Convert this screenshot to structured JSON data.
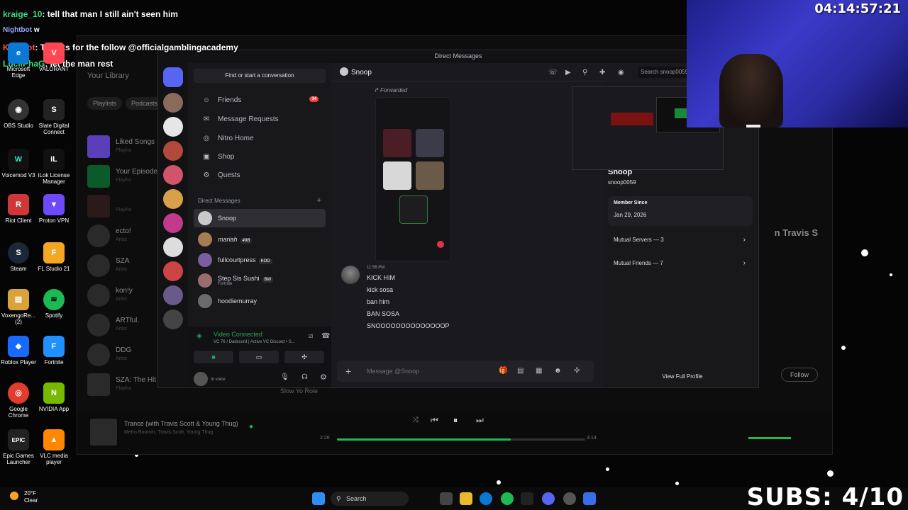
{
  "stream": {
    "clock": "04:14:57:21",
    "subs": "SUBS: 4/10"
  },
  "chat": [
    {
      "name": "kraige_10",
      "text": ": tell that man I still ain't seen him",
      "color": "green"
    },
    {
      "name": "Nightbot",
      "text": " w",
      "color": "green"
    },
    {
      "name": "KickBot",
      "text": ": Thanks for the follow @officialgamblingacademy",
      "color": "red"
    },
    {
      "name": "LuciiPhaG",
      "text": ": let the man rest",
      "color": "green"
    }
  ],
  "desktop_icons": [
    {
      "label": "Microsoft Edge",
      "color": "#0a78d4",
      "glyph": "e"
    },
    {
      "label": "VALORANT",
      "color": "#ff4655",
      "glyph": "V"
    },
    {
      "label": "OBS Studio",
      "color": "#333",
      "glyph": "◉"
    },
    {
      "label": "Slate Digital Connect",
      "color": "#222",
      "glyph": "S"
    },
    {
      "label": "Voicemod V3",
      "color": "#111",
      "glyph": "W"
    },
    {
      "label": "iLok License Manager",
      "color": "#111",
      "glyph": "iL"
    },
    {
      "label": "Riot Client",
      "color": "#d13639",
      "glyph": "R"
    },
    {
      "label": "Proton VPN",
      "color": "#6d4aff",
      "glyph": "▼"
    },
    {
      "label": "Steam",
      "color": "#1b2838",
      "glyph": "S"
    },
    {
      "label": "FL Studio 21",
      "color": "#f5a623",
      "glyph": "F"
    },
    {
      "label": "VoxengoRe... (2)",
      "color": "#d9a23b",
      "glyph": "▤"
    },
    {
      "label": "Spotify",
      "color": "#1db954",
      "glyph": "≋"
    },
    {
      "label": "Roblox Player",
      "color": "#1769ff",
      "glyph": "◆"
    },
    {
      "label": "Fortnite",
      "color": "#1e90ff",
      "glyph": "F"
    },
    {
      "label": "Google Chrome",
      "color": "#e33b2e",
      "glyph": "◎"
    },
    {
      "label": "NVIDIA App",
      "color": "#76b900",
      "glyph": "N"
    },
    {
      "label": "Epic Games Launcher",
      "color": "#222",
      "glyph": "EPIC"
    },
    {
      "label": "VLC media player",
      "color": "#ff8800",
      "glyph": "▲"
    }
  ],
  "spotify": {
    "library_title": "Your Library",
    "chips": [
      "Playlists",
      "Podcasts"
    ],
    "items": [
      {
        "title": "Liked Songs",
        "sub": "Playlist"
      },
      {
        "title": "Your Episodes",
        "sub": "Playlist"
      },
      {
        "title": "",
        "sub": "Playlist"
      },
      {
        "title": "ecto!",
        "sub": "Artist"
      },
      {
        "title": "SZA",
        "sub": "Artist"
      },
      {
        "title": "kon!y",
        "sub": "Artist"
      },
      {
        "title": "ARTful.",
        "sub": "Artist"
      },
      {
        "title": "DDG",
        "sub": "Artist"
      },
      {
        "title": "SZA: The Hit",
        "sub": "Playlist"
      }
    ],
    "now_playing_title": "Trance (with Travis Scott & Young Thug)",
    "now_playing_artist": "Metro Boomin, Travis Scott, Young Thug",
    "time_elapsed": "2:26",
    "time_total": "3:14",
    "progress": 0.7,
    "right_title": "n Travis S",
    "follow_label": "Follow",
    "row_title": "Slow Yo Role"
  },
  "discord": {
    "window_title": "Direct Messages",
    "find_placeholder": "Find or start a conversation",
    "nav": [
      {
        "label": "Friends",
        "icon": "friends-icon",
        "badge": "34"
      },
      {
        "label": "Message Requests",
        "icon": "mail-icon",
        "badge": ""
      },
      {
        "label": "Nitro Home",
        "icon": "nitro-icon",
        "badge": ""
      },
      {
        "label": "Shop",
        "icon": "shop-icon",
        "badge": ""
      },
      {
        "label": "Quests",
        "icon": "quests-icon",
        "badge": ""
      }
    ],
    "dm_header": "Direct Messages",
    "dms": [
      {
        "name": "Snoop",
        "sub": "",
        "tag": "",
        "active": true,
        "color": "#c9c9c9"
      },
      {
        "name": "mariah",
        "sub": "",
        "tag": "49B",
        "active": false,
        "color": "#a67c52"
      },
      {
        "name": "fullcourtpress",
        "sub": "",
        "tag": "KOD",
        "active": false,
        "color": "#7a5fa0"
      },
      {
        "name": "Step Sis Sushi",
        "sub": "Fortnite",
        "tag": "BW",
        "active": false,
        "color": "#9a6d6d"
      },
      {
        "name": "hoodiemurray",
        "sub": "",
        "tag": "",
        "active": false,
        "color": "#6b6b6b"
      }
    ],
    "voice": {
      "title": "Video Connected",
      "subtitle": "VC 76 / Dadscord | Active VC Discord • S...",
      "status": "In voice"
    },
    "chat_name": "Snoop",
    "search_placeholder": "Search snoop0059",
    "forwarded_label": "Forwarded",
    "message_time": "11:56 PM",
    "messages": [
      "KICK HIM",
      "kick sosa",
      "ban him",
      "BAN SOSA",
      "SNOOOOOOOOOOOOOOP"
    ],
    "composer_placeholder": "Message @Snoop",
    "profile": {
      "name": "Snoop",
      "username": "snoop0059",
      "member_since_label": "Member Since",
      "member_since": "Jan 29, 2026",
      "mutual_servers": "Mutual Servers — 3",
      "mutual_friends": "Mutual Friends — 7",
      "view_full": "View Full Profile"
    }
  },
  "taskbar": {
    "temp": "20°F",
    "condition": "Clear",
    "search": "Search"
  }
}
